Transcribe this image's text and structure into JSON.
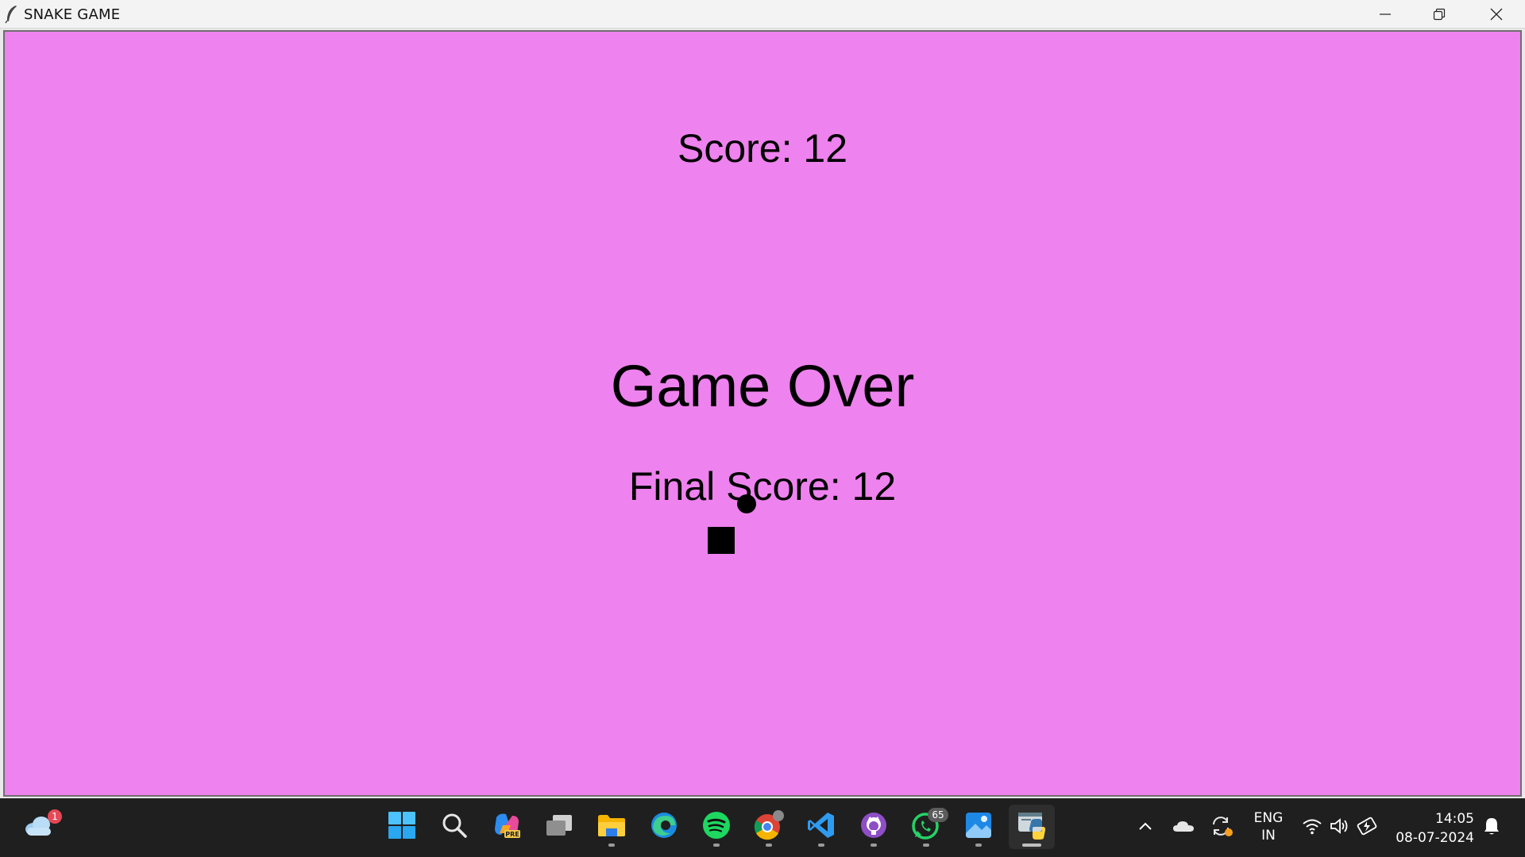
{
  "window": {
    "title": "SNAKE GAME",
    "icon": "feather-icon"
  },
  "game": {
    "score_text": "Score: 12",
    "game_over_text": "Game Over",
    "final_score_text": "Final Score: 12",
    "background_color": "#EE82EE",
    "food_color": "#000000",
    "snake_color": "#000000"
  },
  "taskbar": {
    "weather_badge": "1",
    "apps": [
      {
        "name": "start-icon"
      },
      {
        "name": "search-icon"
      },
      {
        "name": "copilot-icon",
        "label": "PRE"
      },
      {
        "name": "task-view-icon"
      },
      {
        "name": "file-explorer-icon"
      },
      {
        "name": "edge-icon"
      },
      {
        "name": "spotify-icon"
      },
      {
        "name": "chrome-icon"
      },
      {
        "name": "vscode-icon"
      },
      {
        "name": "github-desktop-icon"
      },
      {
        "name": "whatsapp-icon",
        "badge": "65"
      },
      {
        "name": "photos-icon"
      },
      {
        "name": "python-icon"
      }
    ],
    "language_line1": "ENG",
    "language_line2": "IN",
    "time": "14:05",
    "date": "08-07-2024"
  }
}
